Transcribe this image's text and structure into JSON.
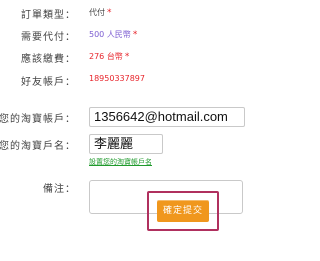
{
  "form": {
    "order_type": {
      "label": "訂單類型：",
      "value": "代付",
      "star": "*"
    },
    "amount_needed": {
      "label": "需要代付：",
      "value": "500 人民幣",
      "star": "*"
    },
    "payable": {
      "label": "應該繳費：",
      "value": "276 台幣",
      "star": "*"
    },
    "friend_account": {
      "label": "好友帳戶：",
      "value": "18950337897"
    },
    "account": {
      "label": "您的淘寶帳戶：",
      "value": "1356642@hotmail.com"
    },
    "account_name": {
      "label": "您的淘寶戶名：",
      "value": "李麗麗",
      "link": "設置您的淘寶帳戶名"
    },
    "remarks": {
      "label": "備注：",
      "value": ""
    },
    "submit_label": "確定提交"
  },
  "colors": {
    "star": "#e8262d",
    "amount": "#7b5bd1",
    "payable": "#e8262d",
    "friend_account": "#e8262d",
    "link": "#1f9a2c",
    "button": "#f0971d",
    "highlight": "#b0305e"
  }
}
